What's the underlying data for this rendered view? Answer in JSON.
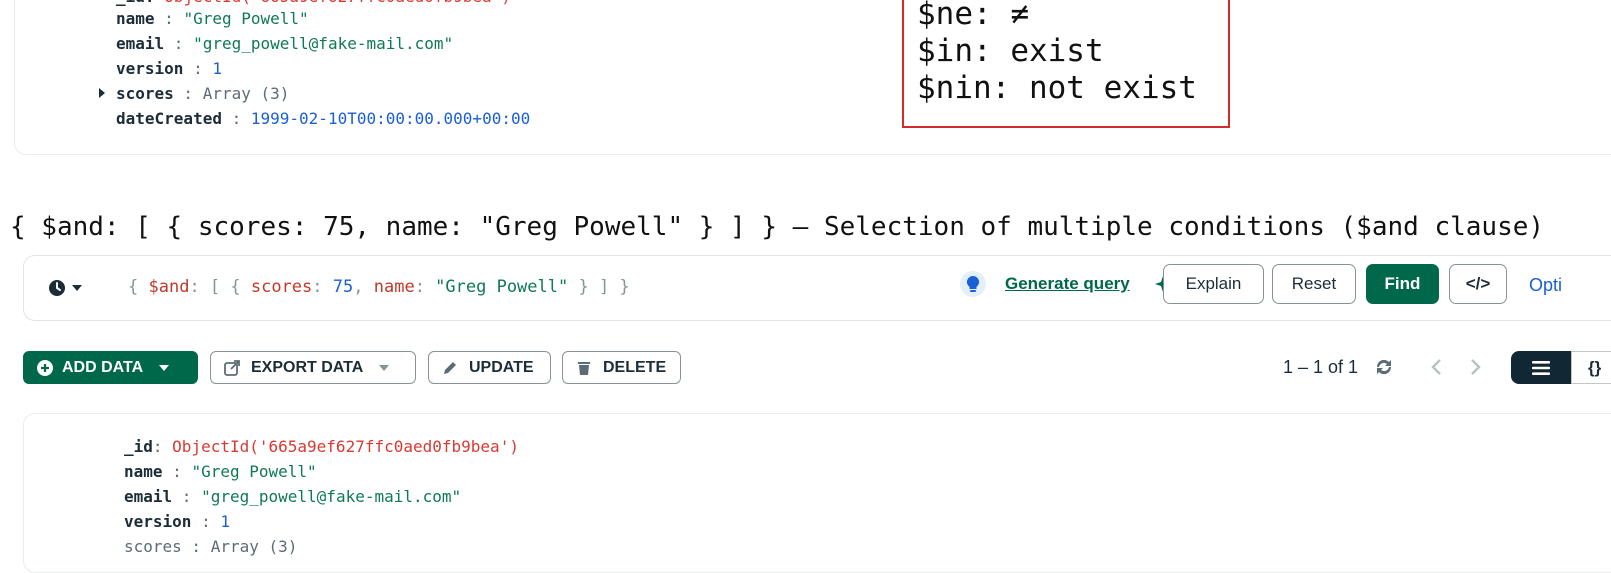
{
  "top_document": {
    "fields": [
      {
        "key": "name",
        "value": "\"Greg Powell\"",
        "type": "str"
      },
      {
        "key": "email",
        "value": "\"greg_powell@fake-mail.com\"",
        "type": "str"
      },
      {
        "key": "version",
        "value": "1",
        "type": "num"
      },
      {
        "key": "scores",
        "value": "Array (3)",
        "type": "arr"
      },
      {
        "key": "dateCreated",
        "value": "1999-02-10T00:00:00.000+00:00",
        "type": "date"
      }
    ]
  },
  "note": {
    "lines": [
      "$ne: ≠",
      "$in: exist",
      "$nin: not exist"
    ]
  },
  "headline": "{ $and: [ { scores: 75, name: \"Greg Powell\" } ] } – Selection of multiple conditions ($and clause)",
  "query_bar": {
    "query_text": {
      "open": "{ ",
      "and_op": "$and",
      "colon1": ": [ { ",
      "scores_key": "scores",
      "colon2": ": ",
      "scores_val": "75",
      "comma": ", ",
      "name_key": "name",
      "colon3": ": ",
      "name_val": "\"Greg Powell\"",
      "close": " } ] }"
    },
    "generate_query": "Generate query",
    "explain": "Explain",
    "reset": "Reset",
    "find": "Find",
    "code_icon_label": "</>",
    "options": "Opti"
  },
  "toolbar": {
    "add_data": "ADD DATA",
    "export_data": "EXPORT DATA",
    "update": "UPDATE",
    "delete": "DELETE",
    "pagination": "1 – 1 of 1",
    "json_view_label": "{}"
  },
  "result_document": {
    "id_key": "_id",
    "id_value": "ObjectId('665a9ef627ffc0aed0fb9bea')",
    "fields": [
      {
        "key": "name",
        "value": "\"Greg Powell\"",
        "type": "str"
      },
      {
        "key": "email",
        "value": "\"greg_powell@fake-mail.com\"",
        "type": "str"
      },
      {
        "key": "version",
        "value": "1",
        "type": "num"
      }
    ],
    "partial_next": "scores : Array (3)"
  },
  "colors": {
    "brand_green": "#00684a",
    "string_green": "#0f7a52",
    "number_blue": "#1a5fd6",
    "objectid_red": "#d83a32",
    "note_border_red": "#d52b2b"
  }
}
